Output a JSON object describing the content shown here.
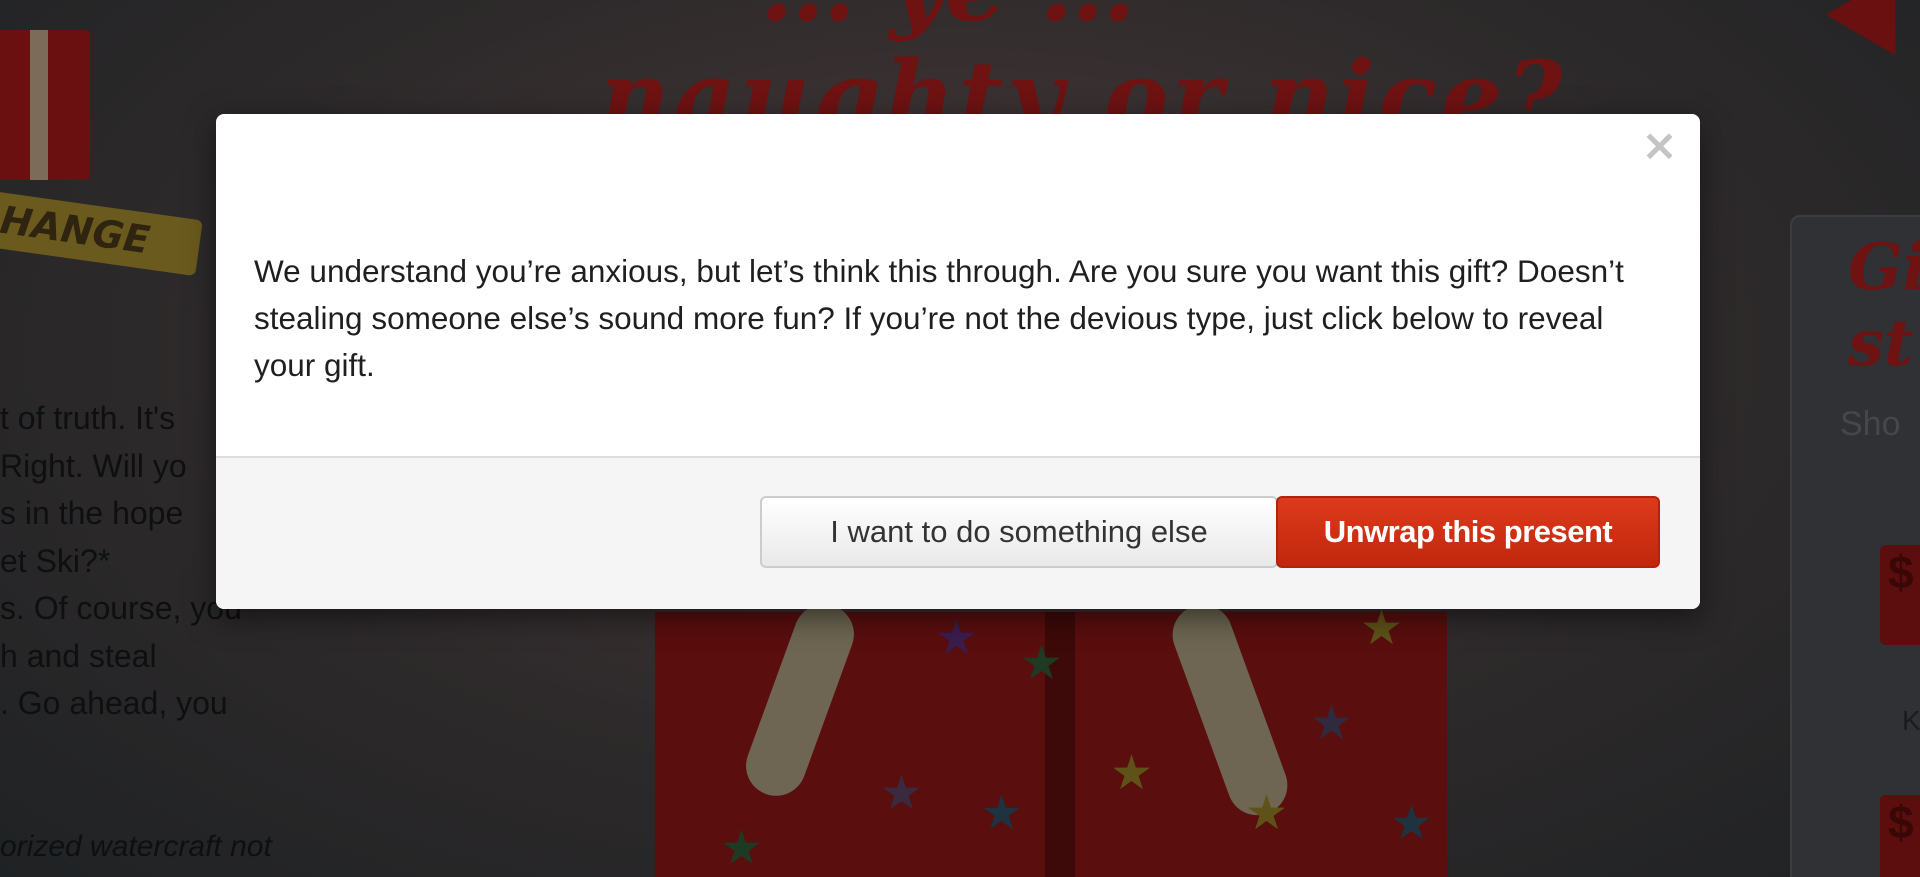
{
  "background": {
    "headline_top": "… ye …",
    "headline": "naughty or nice?",
    "banner_text": "HANGE",
    "body_lines": [
      "t of truth. It's",
      "Right. Will yo",
      "s in the hope",
      "et Ski?*",
      "s. Of course, you",
      "h and steal",
      ". Go ahead, you"
    ],
    "footnote": "orized watercraft not",
    "sidebar_script": [
      "Gi",
      "st"
    ],
    "sidebar_sub": "Sho",
    "price_symbol": "$",
    "sidebar_letter": "K"
  },
  "modal": {
    "close_glyph": "×",
    "message": "We understand you’re anxious, but let’s think this through. Are you sure you want this gift? Doesn’t stealing someone else’s sound more fun? If you’re not the devious type, just click below to reveal your gift.",
    "secondary_button": "I want to do something else",
    "primary_button": "Unwrap this present"
  },
  "colors": {
    "primary_button": "#c8300f",
    "backdrop": "#2e2a2b",
    "modal_bg": "#ffffff",
    "footer_bg": "#f5f5f5"
  }
}
